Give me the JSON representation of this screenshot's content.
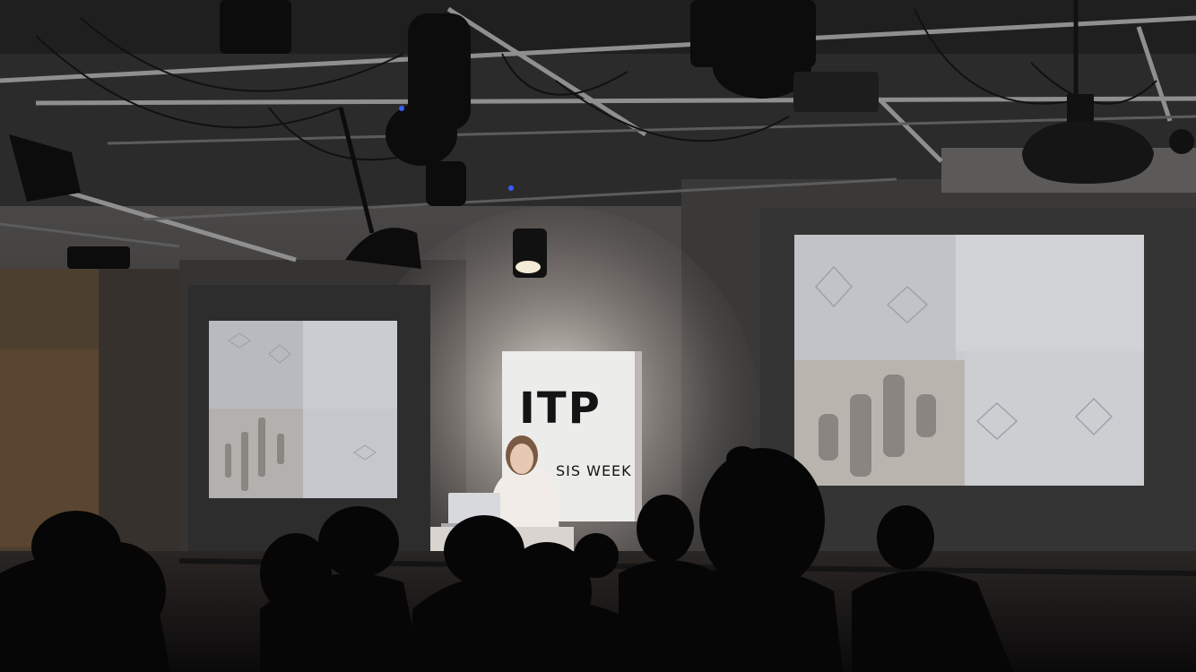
{
  "sign": {
    "logo": "ITP",
    "caption": "SIS WEEK"
  },
  "colors": {
    "ceiling": "#2b2b2b",
    "wall": "#3c3a39",
    "screen": "#c9cacd",
    "sign_background": "#ececea",
    "sign_text": "#141414"
  },
  "icons": [
    "projector-screen-left",
    "projector-screen-right",
    "presenter",
    "laptop",
    "stage-spotlight",
    "audience"
  ]
}
